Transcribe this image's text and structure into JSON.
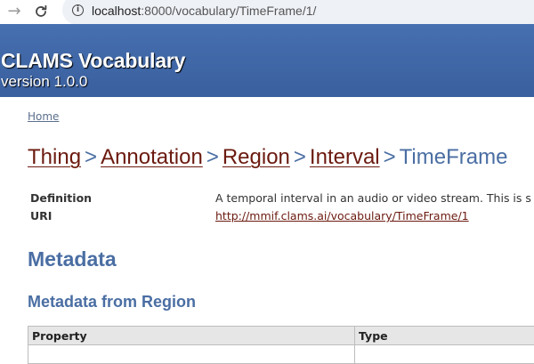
{
  "browser": {
    "url_host": "localhost",
    "url_path": ":8000/vocabulary/TimeFrame/1/"
  },
  "header": {
    "title": "CLAMS Vocabulary",
    "version": "version 1.0.0"
  },
  "nav": {
    "home": "Home"
  },
  "breadcrumb": {
    "items": [
      "Thing",
      "Annotation",
      "Region",
      "Interval"
    ],
    "separator": ">",
    "current": "TimeFrame"
  },
  "properties": {
    "definition_label": "Definition",
    "definition_value": "A temporal interval in an audio or video stream. This is s",
    "uri_label": "URI",
    "uri_value": "http://mmif.clams.ai/vocabulary/TimeFrame/1"
  },
  "sections": {
    "metadata_heading": "Metadata",
    "metadata_from_heading": "Metadata from Region"
  },
  "metadata_table": {
    "headers": [
      "Property",
      "Type"
    ]
  },
  "colors": {
    "header_bg": "#3f64a3",
    "link_dark": "#6b1a0f",
    "heading_blue": "#4a6ea3"
  }
}
